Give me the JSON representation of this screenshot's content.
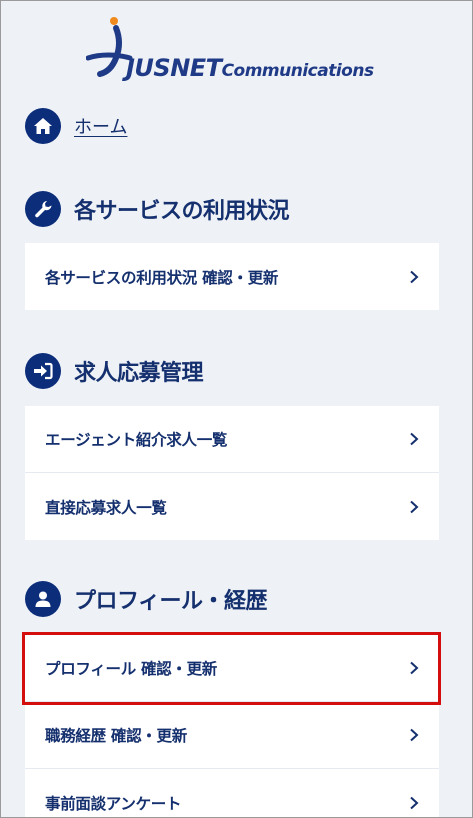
{
  "logo": {
    "brand_main": "JUSNET",
    "brand_sub": "Communications"
  },
  "home": {
    "label": "ホーム"
  },
  "sections": [
    {
      "title": "各サービスの利用状況",
      "icon": "wrench-icon",
      "items": [
        {
          "label": "各サービスの利用状況 確認・更新"
        }
      ]
    },
    {
      "title": "求人応募管理",
      "icon": "sign-in-icon",
      "items": [
        {
          "label": "エージェント紹介求人一覧"
        },
        {
          "label": "直接応募求人一覧"
        }
      ]
    },
    {
      "title": "プロフィール・経歴",
      "icon": "user-icon",
      "items": [
        {
          "label": "プロフィール 確認・更新",
          "highlighted": true
        },
        {
          "label": "職務経歴 確認・更新"
        },
        {
          "label": "事前面談アンケート"
        }
      ]
    }
  ],
  "colors": {
    "primary": "#0b2d7a",
    "text": "#15306e",
    "background": "#eef1f6",
    "highlight": "#d40d0d",
    "logo_dot": "#f08a1c"
  }
}
